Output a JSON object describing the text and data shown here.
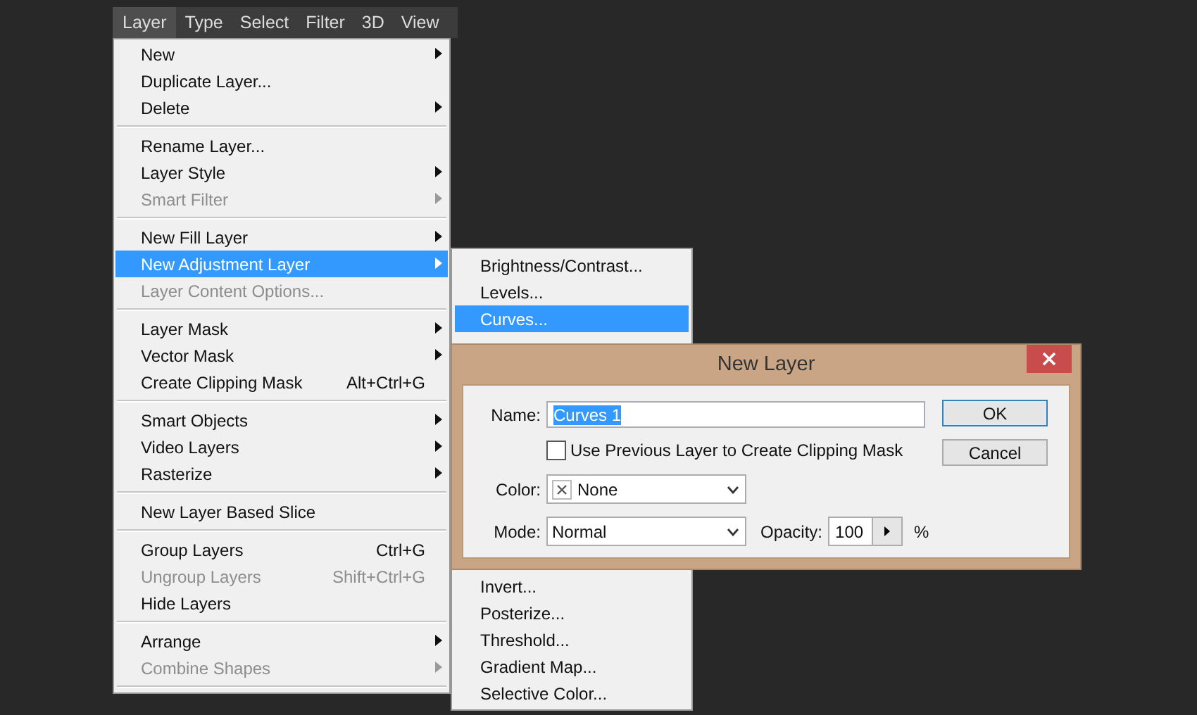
{
  "menu_bar": [
    {
      "label": "Layer",
      "selected": true
    },
    {
      "label": "Type",
      "selected": false
    },
    {
      "label": "Select",
      "selected": false
    },
    {
      "label": "Filter",
      "selected": false
    },
    {
      "label": "3D",
      "selected": false
    },
    {
      "label": "View",
      "selected": false
    }
  ],
  "layer_menu": [
    {
      "kind": "item",
      "label": "New",
      "submenu": true,
      "disabled": false,
      "selected": false
    },
    {
      "kind": "item",
      "label": "Duplicate Layer...",
      "submenu": false,
      "disabled": false,
      "selected": false
    },
    {
      "kind": "item",
      "label": "Delete",
      "submenu": true,
      "disabled": false,
      "selected": false
    },
    {
      "kind": "separator"
    },
    {
      "kind": "item",
      "label": "Rename Layer...",
      "submenu": false,
      "disabled": false,
      "selected": false
    },
    {
      "kind": "item",
      "label": "Layer Style",
      "submenu": true,
      "disabled": false,
      "selected": false
    },
    {
      "kind": "item",
      "label": "Smart Filter",
      "submenu": true,
      "disabled": true,
      "selected": false
    },
    {
      "kind": "separator"
    },
    {
      "kind": "item",
      "label": "New Fill Layer",
      "submenu": true,
      "disabled": false,
      "selected": false
    },
    {
      "kind": "item",
      "label": "New Adjustment Layer",
      "submenu": true,
      "disabled": false,
      "selected": true
    },
    {
      "kind": "item",
      "label": "Layer Content Options...",
      "submenu": false,
      "disabled": true,
      "selected": false
    },
    {
      "kind": "separator"
    },
    {
      "kind": "item",
      "label": "Layer Mask",
      "submenu": true,
      "disabled": false,
      "selected": false
    },
    {
      "kind": "item",
      "label": "Vector Mask",
      "submenu": true,
      "disabled": false,
      "selected": false
    },
    {
      "kind": "item",
      "label": "Create Clipping Mask",
      "shortcut": "Alt+Ctrl+G",
      "submenu": false,
      "disabled": false,
      "selected": false
    },
    {
      "kind": "separator"
    },
    {
      "kind": "item",
      "label": "Smart Objects",
      "submenu": true,
      "disabled": false,
      "selected": false
    },
    {
      "kind": "item",
      "label": "Video Layers",
      "submenu": true,
      "disabled": false,
      "selected": false
    },
    {
      "kind": "item",
      "label": "Rasterize",
      "submenu": true,
      "disabled": false,
      "selected": false
    },
    {
      "kind": "separator"
    },
    {
      "kind": "item",
      "label": "New Layer Based Slice",
      "submenu": false,
      "disabled": false,
      "selected": false
    },
    {
      "kind": "separator"
    },
    {
      "kind": "item",
      "label": "Group Layers",
      "shortcut": "Ctrl+G",
      "submenu": false,
      "disabled": false,
      "selected": false
    },
    {
      "kind": "item",
      "label": "Ungroup Layers",
      "shortcut": "Shift+Ctrl+G",
      "submenu": false,
      "disabled": true,
      "selected": false
    },
    {
      "kind": "item",
      "label": "Hide Layers",
      "submenu": false,
      "disabled": false,
      "selected": false
    },
    {
      "kind": "separator"
    },
    {
      "kind": "item",
      "label": "Arrange",
      "submenu": true,
      "disabled": false,
      "selected": false
    },
    {
      "kind": "item",
      "label": "Combine Shapes",
      "submenu": true,
      "disabled": true,
      "selected": false
    },
    {
      "kind": "separator"
    }
  ],
  "adjustment_submenu": {
    "items_above": [
      {
        "label": "Brightness/Contrast...",
        "selected": false
      },
      {
        "label": "Levels...",
        "selected": false
      },
      {
        "label": "Curves...",
        "selected": true
      }
    ],
    "items_below": [
      {
        "label": "Invert...",
        "selected": false
      },
      {
        "label": "Posterize...",
        "selected": false
      },
      {
        "label": "Threshold...",
        "selected": false
      },
      {
        "label": "Gradient Map...",
        "selected": false
      },
      {
        "label": "Selective Color...",
        "selected": false
      }
    ]
  },
  "dialog": {
    "title": "New Layer",
    "name_label": "Name:",
    "name_value": "Curves 1",
    "name_text_selected": true,
    "checkbox": {
      "label": "Use Previous Layer to Create Clipping Mask",
      "checked": false
    },
    "color_label": "Color:",
    "color_value": "None",
    "mode_label": "Mode:",
    "mode_value": "Normal",
    "opacity_label": "Opacity:",
    "opacity_value": "100",
    "opacity_unit": "%",
    "buttons": [
      {
        "label": "OK",
        "default": true
      },
      {
        "label": "Cancel",
        "default": false
      }
    ]
  }
}
